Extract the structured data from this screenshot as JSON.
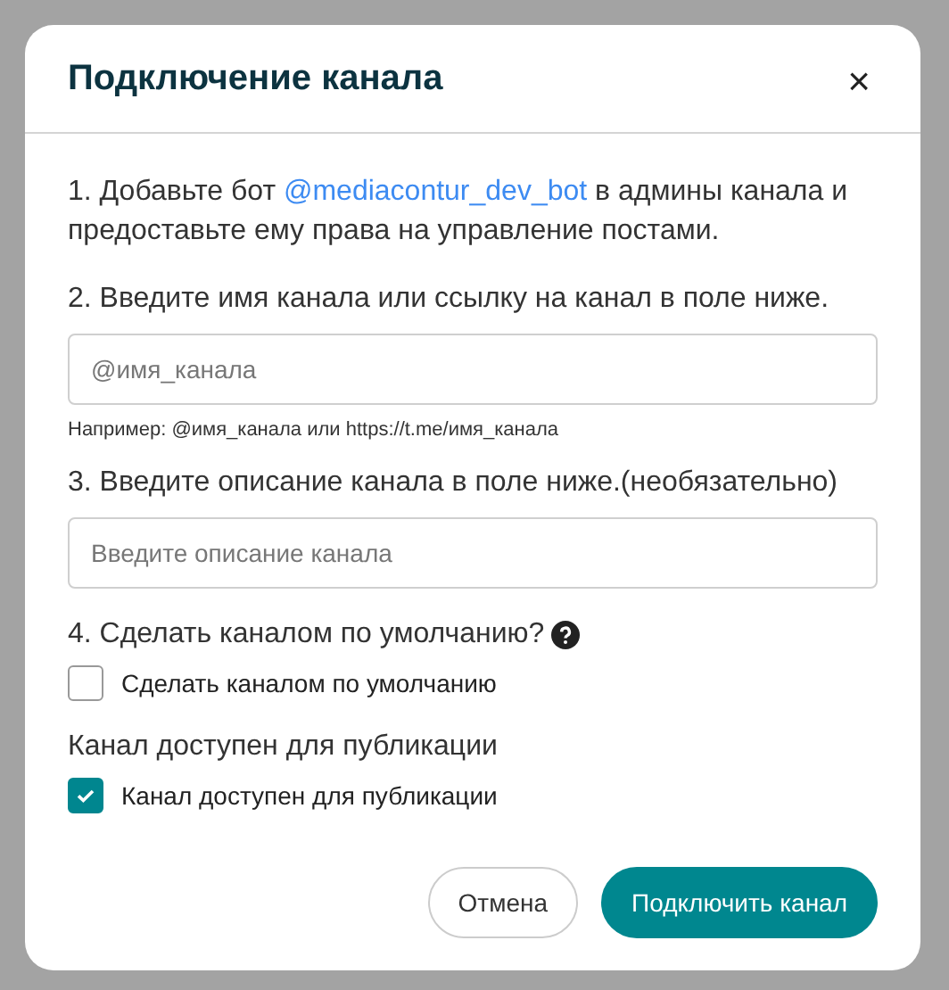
{
  "dialog": {
    "title": "Подключение канала",
    "close": "×",
    "step1": {
      "before": "1. Добавьте бот",
      "link": "@mediacontur_dev_bot",
      "after": "в админы канала и предоставьте ему права на управление постами."
    },
    "step2": {
      "label": "2. Введите имя канала или ссылку на канал в поле ниже.",
      "placeholder": "@имя_канала",
      "hint": "Например: @имя_канала или https://t.me/имя_канала"
    },
    "step3": {
      "label": "3. Введите описание канала в поле ниже.(необязательно)",
      "placeholder": "Введите описание канала"
    },
    "step4": {
      "label": "4. Сделать каналом по умолчанию?",
      "checkbox": {
        "label": "Сделать каналом по умолчанию",
        "checked": false
      }
    },
    "publish": {
      "label": "Канал доступен для публикации",
      "checkbox": {
        "label": "Канал доступен для публикации",
        "checked": true
      }
    },
    "buttons": [
      {
        "label": "Отмена",
        "kind": "secondary"
      },
      {
        "label": "Подключить канал",
        "kind": "primary"
      }
    ]
  }
}
